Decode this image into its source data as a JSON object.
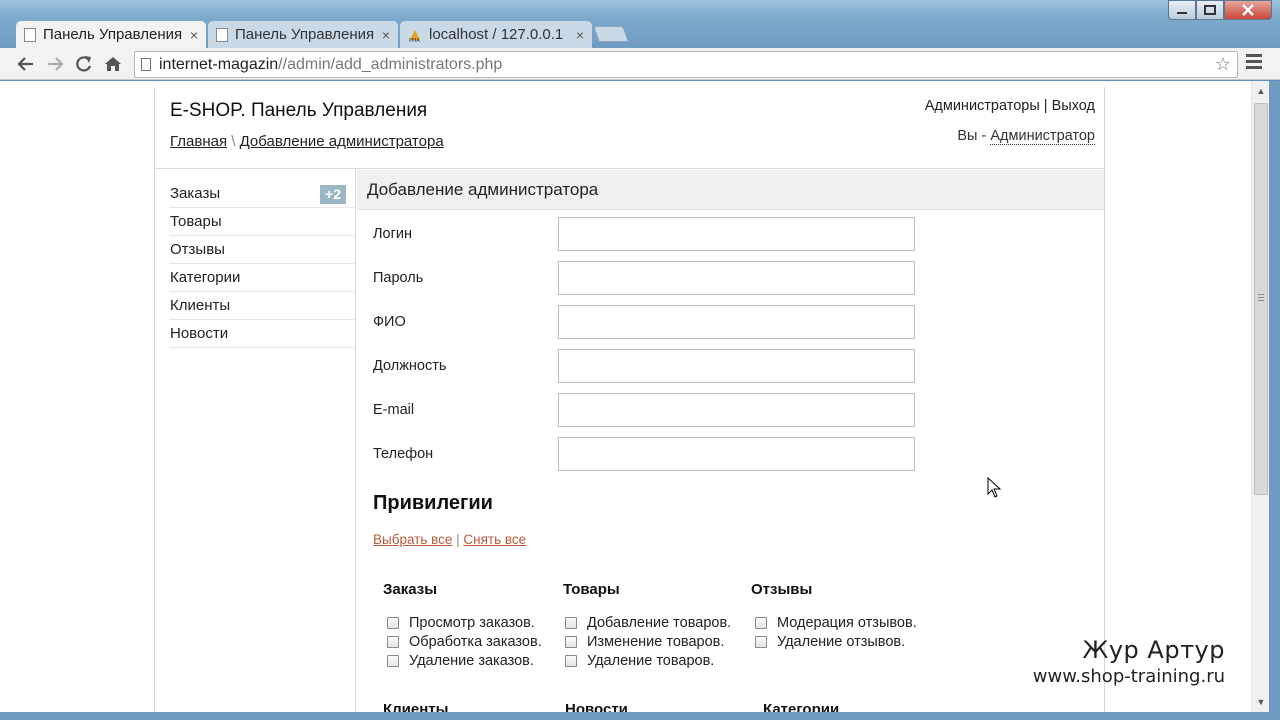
{
  "browser": {
    "tabs": [
      {
        "title": "Панель Управления",
        "close": "×"
      },
      {
        "title": "Панель Управления",
        "close": "×"
      },
      {
        "title": "localhost / 127.0.0.1",
        "close": "×"
      }
    ],
    "url_host": "internet-magazin",
    "url_path": "//admin/add_administrators.php"
  },
  "header": {
    "brand": "E-SHOP. Панель Управления",
    "breadcrumb_home": "Главная",
    "breadcrumb_sep": " \\ ",
    "breadcrumb_current": "Добавление администратора",
    "link_admins": "Администраторы",
    "link_sep": " | ",
    "link_logout": "Выход",
    "whoami_prefix": "Вы - ",
    "whoami_user": "Администратор"
  },
  "sidebar": {
    "items": [
      {
        "label": "Заказы",
        "badge": "+2"
      },
      {
        "label": "Товары"
      },
      {
        "label": "Отзывы"
      },
      {
        "label": "Категории"
      },
      {
        "label": "Клиенты"
      },
      {
        "label": "Новости"
      }
    ]
  },
  "form": {
    "title": "Добавление администратора",
    "fields": [
      {
        "label": "Логин",
        "value": ""
      },
      {
        "label": "Пароль",
        "value": ""
      },
      {
        "label": "ФИО",
        "value": ""
      },
      {
        "label": "Должность",
        "value": ""
      },
      {
        "label": "E-mail",
        "value": ""
      },
      {
        "label": "Телефон",
        "value": ""
      }
    ]
  },
  "privileges": {
    "title": "Привилегии",
    "select_all": "Выбрать все",
    "sep": " | ",
    "deselect_all": "Снять все",
    "groups": [
      {
        "title": "Заказы",
        "items": [
          "Просмотр заказов.",
          "Обработка заказов.",
          "Удаление заказов."
        ]
      },
      {
        "title": "Товары",
        "items": [
          "Добавление товаров.",
          "Изменение товаров.",
          "Удаление товаров."
        ]
      },
      {
        "title": "Отзывы",
        "items": [
          "Модерация отзывов.",
          "Удаление отзывов."
        ]
      },
      {
        "title": "Клиенты",
        "items": []
      },
      {
        "title": "Новости",
        "items": []
      },
      {
        "title": "Категории",
        "items": []
      }
    ]
  },
  "watermark": {
    "name": "Жур Артур",
    "site": "www.shop-training.ru"
  }
}
